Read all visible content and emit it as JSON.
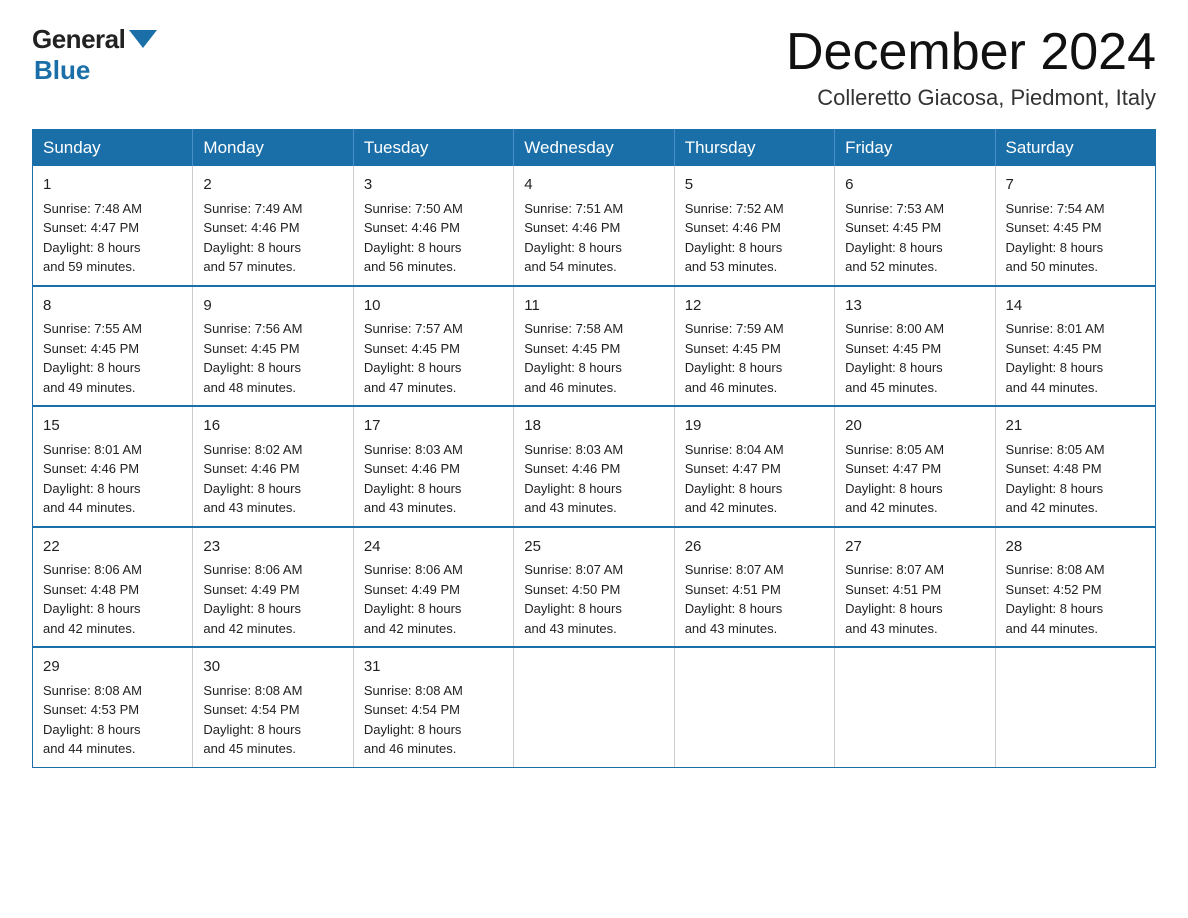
{
  "logo": {
    "general": "General",
    "blue": "Blue"
  },
  "title": "December 2024",
  "location": "Colleretto Giacosa, Piedmont, Italy",
  "days_header": [
    "Sunday",
    "Monday",
    "Tuesday",
    "Wednesday",
    "Thursday",
    "Friday",
    "Saturday"
  ],
  "weeks": [
    [
      {
        "day": "1",
        "sunrise": "7:48 AM",
        "sunset": "4:47 PM",
        "daylight": "8 hours and 59 minutes."
      },
      {
        "day": "2",
        "sunrise": "7:49 AM",
        "sunset": "4:46 PM",
        "daylight": "8 hours and 57 minutes."
      },
      {
        "day": "3",
        "sunrise": "7:50 AM",
        "sunset": "4:46 PM",
        "daylight": "8 hours and 56 minutes."
      },
      {
        "day": "4",
        "sunrise": "7:51 AM",
        "sunset": "4:46 PM",
        "daylight": "8 hours and 54 minutes."
      },
      {
        "day": "5",
        "sunrise": "7:52 AM",
        "sunset": "4:46 PM",
        "daylight": "8 hours and 53 minutes."
      },
      {
        "day": "6",
        "sunrise": "7:53 AM",
        "sunset": "4:45 PM",
        "daylight": "8 hours and 52 minutes."
      },
      {
        "day": "7",
        "sunrise": "7:54 AM",
        "sunset": "4:45 PM",
        "daylight": "8 hours and 50 minutes."
      }
    ],
    [
      {
        "day": "8",
        "sunrise": "7:55 AM",
        "sunset": "4:45 PM",
        "daylight": "8 hours and 49 minutes."
      },
      {
        "day": "9",
        "sunrise": "7:56 AM",
        "sunset": "4:45 PM",
        "daylight": "8 hours and 48 minutes."
      },
      {
        "day": "10",
        "sunrise": "7:57 AM",
        "sunset": "4:45 PM",
        "daylight": "8 hours and 47 minutes."
      },
      {
        "day": "11",
        "sunrise": "7:58 AM",
        "sunset": "4:45 PM",
        "daylight": "8 hours and 46 minutes."
      },
      {
        "day": "12",
        "sunrise": "7:59 AM",
        "sunset": "4:45 PM",
        "daylight": "8 hours and 46 minutes."
      },
      {
        "day": "13",
        "sunrise": "8:00 AM",
        "sunset": "4:45 PM",
        "daylight": "8 hours and 45 minutes."
      },
      {
        "day": "14",
        "sunrise": "8:01 AM",
        "sunset": "4:45 PM",
        "daylight": "8 hours and 44 minutes."
      }
    ],
    [
      {
        "day": "15",
        "sunrise": "8:01 AM",
        "sunset": "4:46 PM",
        "daylight": "8 hours and 44 minutes."
      },
      {
        "day": "16",
        "sunrise": "8:02 AM",
        "sunset": "4:46 PM",
        "daylight": "8 hours and 43 minutes."
      },
      {
        "day": "17",
        "sunrise": "8:03 AM",
        "sunset": "4:46 PM",
        "daylight": "8 hours and 43 minutes."
      },
      {
        "day": "18",
        "sunrise": "8:03 AM",
        "sunset": "4:46 PM",
        "daylight": "8 hours and 43 minutes."
      },
      {
        "day": "19",
        "sunrise": "8:04 AM",
        "sunset": "4:47 PM",
        "daylight": "8 hours and 42 minutes."
      },
      {
        "day": "20",
        "sunrise": "8:05 AM",
        "sunset": "4:47 PM",
        "daylight": "8 hours and 42 minutes."
      },
      {
        "day": "21",
        "sunrise": "8:05 AM",
        "sunset": "4:48 PM",
        "daylight": "8 hours and 42 minutes."
      }
    ],
    [
      {
        "day": "22",
        "sunrise": "8:06 AM",
        "sunset": "4:48 PM",
        "daylight": "8 hours and 42 minutes."
      },
      {
        "day": "23",
        "sunrise": "8:06 AM",
        "sunset": "4:49 PM",
        "daylight": "8 hours and 42 minutes."
      },
      {
        "day": "24",
        "sunrise": "8:06 AM",
        "sunset": "4:49 PM",
        "daylight": "8 hours and 42 minutes."
      },
      {
        "day": "25",
        "sunrise": "8:07 AM",
        "sunset": "4:50 PM",
        "daylight": "8 hours and 43 minutes."
      },
      {
        "day": "26",
        "sunrise": "8:07 AM",
        "sunset": "4:51 PM",
        "daylight": "8 hours and 43 minutes."
      },
      {
        "day": "27",
        "sunrise": "8:07 AM",
        "sunset": "4:51 PM",
        "daylight": "8 hours and 43 minutes."
      },
      {
        "day": "28",
        "sunrise": "8:08 AM",
        "sunset": "4:52 PM",
        "daylight": "8 hours and 44 minutes."
      }
    ],
    [
      {
        "day": "29",
        "sunrise": "8:08 AM",
        "sunset": "4:53 PM",
        "daylight": "8 hours and 44 minutes."
      },
      {
        "day": "30",
        "sunrise": "8:08 AM",
        "sunset": "4:54 PM",
        "daylight": "8 hours and 45 minutes."
      },
      {
        "day": "31",
        "sunrise": "8:08 AM",
        "sunset": "4:54 PM",
        "daylight": "8 hours and 46 minutes."
      },
      null,
      null,
      null,
      null
    ]
  ]
}
